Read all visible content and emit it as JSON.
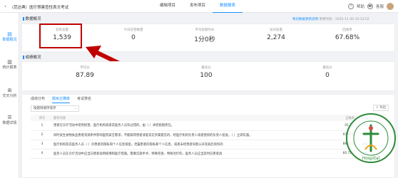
{
  "header": {
    "back_icon": "chevron-left",
    "title": "(范达典）医疗预害查性表文考试",
    "tabs": [
      {
        "label": "编辑项目"
      },
      {
        "label": "发布项目"
      },
      {
        "label": "数据报表"
      }
    ],
    "help_label": "帮助",
    "service_label": "客服"
  },
  "sidebar": {
    "items": [
      {
        "label": "数据概况",
        "icon": "chart-icon"
      },
      {
        "label": "统计报表",
        "icon": "bar-chart-icon"
      },
      {
        "label": "交叉分析",
        "icon": "cross-icon"
      },
      {
        "label": "数据详情",
        "icon": "list-icon"
      }
    ]
  },
  "overview": {
    "title": "数据概况",
    "update_link": "每日数据更新说明",
    "update_time": "更新时间：2020-11-30 16:33:52",
    "stats": [
      {
        "label": "答卷总量",
        "value": "1,539"
      },
      {
        "label": "今日答卷数量",
        "value": "0"
      },
      {
        "label": "平均答题时长",
        "value": "1分0秒"
      },
      {
        "label": "访问总量",
        "value": "2,274"
      },
      {
        "label": "回收率",
        "value": "67.68%"
      }
    ]
  },
  "scores": {
    "title": "成绩概况",
    "stats": [
      {
        "label": "平均分",
        "value": "87.89"
      },
      {
        "label": "最高分",
        "value": "100"
      },
      {
        "label": "最低分",
        "value": "0"
      }
    ]
  },
  "detail": {
    "tabs": [
      {
        "label": "成绩分布"
      },
      {
        "label": "题目正确率"
      },
      {
        "label": "考试排名"
      }
    ],
    "sort_select": "按题目顺序排序",
    "export_label": "导出",
    "columns": [
      "序号",
      "题目内容",
      "正确率",
      "操作"
    ],
    "rows": [
      {
        "no": "1",
        "content": "患者在诊疗活动中受到损害，医疗机构或者其医务人员有过错的，由（ ）承担赔偿责任。",
        "rate": "91.7%",
        "action": "查看"
      },
      {
        "no": "2",
        "content": "同时发生食物食品患者资源条件影响医院安全需求，不能取得患者或者其近亲属意见的，经医疗机构负责人或者授权的负责人批准，（ ）立即实施。",
        "rate": "97.66%",
        "action": "查看"
      },
      {
        "no": "3",
        "content": "医疗机构及其医务人员（ ）对患者的隐私和个人信息保密。泄露患者的隐私和个人信息，或者未经患者同意公开其病历资料的",
        "rate": "88.36%",
        "action": "查看"
      },
      {
        "no": "4",
        "content": "医务人员在诊疗活动中应当向患者说明病情和医疗措施。需要实施手术、特殊检查、特殊治疗的，医务人员应当及时向患者具",
        "rate": "60.75%",
        "action": "查看"
      }
    ]
  },
  "seal": {
    "text": "Hospital"
  },
  "colors": {
    "accent": "#1890ff",
    "highlight": "#c00000",
    "seal": "#2e8b3a"
  }
}
